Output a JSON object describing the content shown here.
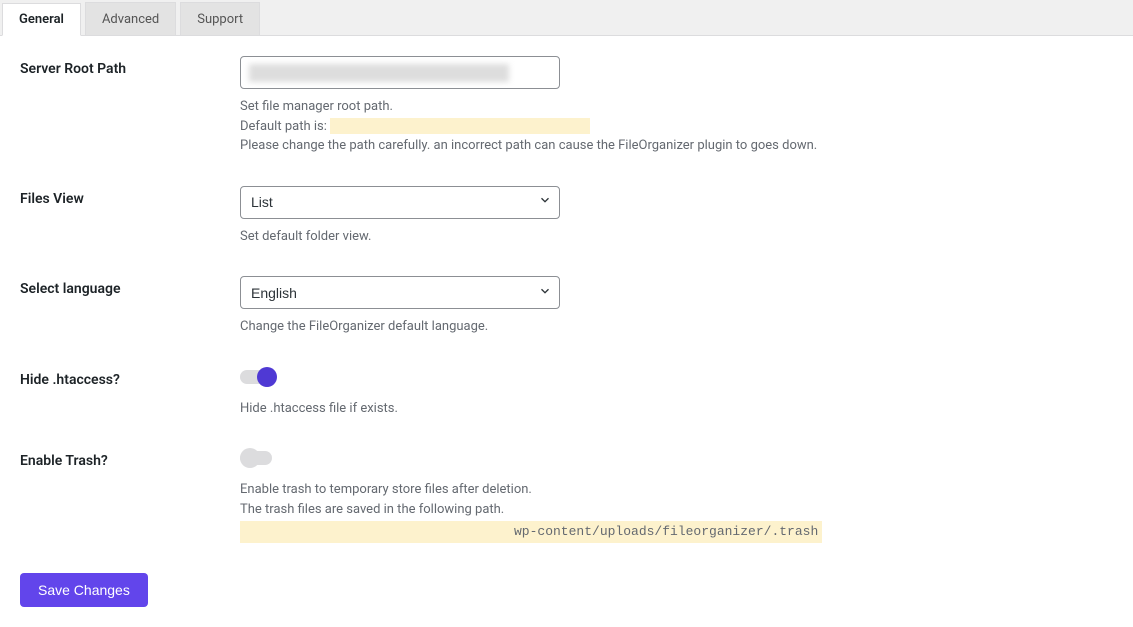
{
  "tabs": {
    "general": "General",
    "advanced": "Advanced",
    "support": "Support"
  },
  "fields": {
    "server_root_path": {
      "label": "Server Root Path",
      "value": "",
      "help1": "Set file manager root path.",
      "help2_prefix": "Default path is: ",
      "help3": "Please change the path carefully. an incorrect path can cause the FileOrganizer plugin to goes down."
    },
    "files_view": {
      "label": "Files View",
      "value": "List",
      "help": "Set default folder view."
    },
    "select_language": {
      "label": "Select language",
      "value": "English",
      "help": "Change the FileOrganizer default language."
    },
    "hide_htaccess": {
      "label": "Hide .htaccess?",
      "help": "Hide .htaccess file if exists."
    },
    "enable_trash": {
      "label": "Enable Trash?",
      "help1": "Enable trash to temporary store files after deletion.",
      "help2": "The trash files are saved in the following path.",
      "path_suffix": "wp-content/uploads/fileorganizer/.trash"
    }
  },
  "buttons": {
    "save": "Save Changes"
  }
}
